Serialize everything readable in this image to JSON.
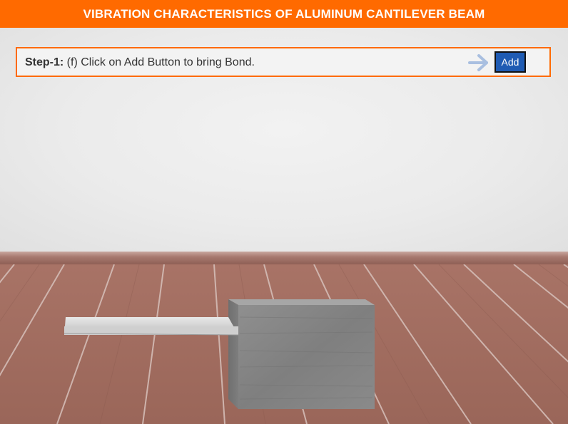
{
  "header": {
    "title": "VIBRATION CHARACTERISTICS OF ALUMINUM CANTILEVER BEAM"
  },
  "instruction": {
    "step_label": "Step-1:",
    "step_text": " (f) Click on Add Button to bring Bond.",
    "add_button_label": "Add"
  },
  "icons": {
    "next": "arrow-right-icon"
  },
  "colors": {
    "header_bg": "#ff6a00",
    "step_border": "#ff6a00",
    "button_bg": "#1f5bb3",
    "arrow": "#a9bfe0"
  }
}
